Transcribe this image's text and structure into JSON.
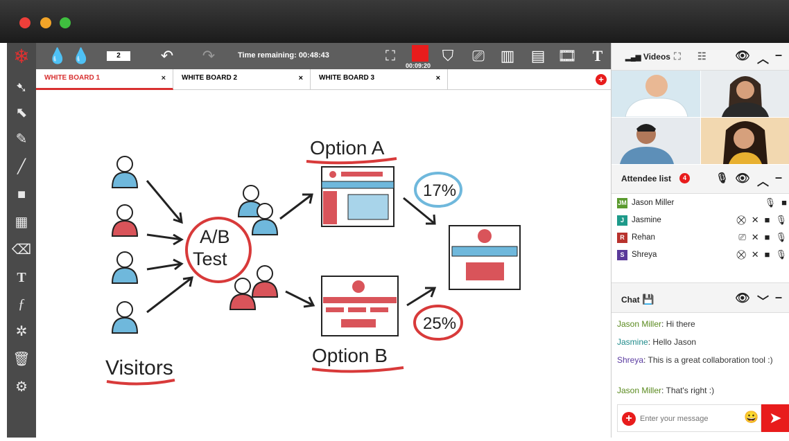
{
  "window": {
    "colors": {
      "close": "#ee3f3a",
      "minimize": "#f2a428",
      "maximize": "#3fbf3f"
    }
  },
  "toolbar": {
    "page_value": "2",
    "timer_text": "Time remaining: 00:48:43",
    "record_time": "00:09:20"
  },
  "tabs": [
    {
      "label": "WHITE BOARD 1",
      "close": "×"
    },
    {
      "label": "WHITE BOARD 2",
      "close": "×"
    },
    {
      "label": "WHITE BOARD 3",
      "close": "×"
    }
  ],
  "add_tab": "+",
  "board": {
    "option_a": "Option A",
    "option_b": "Option B",
    "ab_test_line1": "A/B",
    "ab_test_line2": "Test",
    "pct_a": "17%",
    "pct_b": "25%",
    "visitors": "Visitors"
  },
  "videos_panel": {
    "title": "Videos"
  },
  "attendee_panel": {
    "title": "Attendee list",
    "count": "4",
    "attendees": [
      {
        "initials": "JM",
        "name": "Jason Miller",
        "color": "#5a9a2e"
      },
      {
        "initials": "J",
        "name": "Jasmine",
        "color": "#1e9a8a"
      },
      {
        "initials": "R",
        "name": "Rehan",
        "color": "#b8322d"
      },
      {
        "initials": "S",
        "name": "Shreya",
        "color": "#5a3a9a"
      }
    ]
  },
  "chat_panel": {
    "title": "Chat",
    "messages": [
      {
        "sender": "Jason Miller",
        "text": ": Hi there",
        "color": "#5a8a1e"
      },
      {
        "sender": "Jasmine",
        "text": ": Hello Jason",
        "color": "#1e8a8a"
      },
      {
        "sender": "Shreya",
        "text": ": This is a great collaboration tool :)",
        "color": "#5a3aa0"
      },
      {
        "sender": "Jason Miller",
        "text": ": That's right :)",
        "color": "#5a8a1e"
      }
    ],
    "input_placeholder": "Enter your message"
  }
}
